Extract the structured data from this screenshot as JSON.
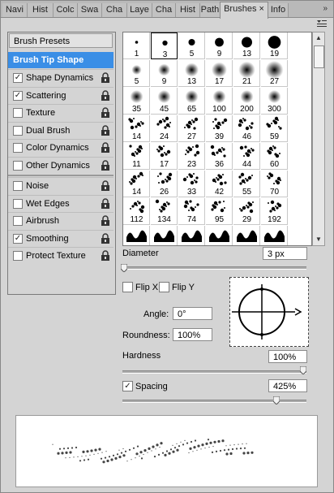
{
  "tabs": [
    "Navi",
    "Hist",
    "Colc",
    "Swa",
    "Cha",
    "Laye",
    "Cha",
    "Hist",
    "Path",
    "Brushes",
    "Info"
  ],
  "active_tab": "Brushes",
  "tab_close": "×",
  "panel_grip": "»",
  "presets_label": "Brush Presets",
  "options": [
    {
      "label": "Brush Tip Shape",
      "checked": null,
      "lock": false
    },
    {
      "label": "Shape Dynamics",
      "checked": true,
      "lock": true
    },
    {
      "label": "Scattering",
      "checked": true,
      "lock": true
    },
    {
      "label": "Texture",
      "checked": false,
      "lock": true
    },
    {
      "label": "Dual Brush",
      "checked": false,
      "lock": true
    },
    {
      "label": "Color Dynamics",
      "checked": false,
      "lock": true
    },
    {
      "label": "Other Dynamics",
      "checked": false,
      "lock": true
    },
    {
      "label": "Noise",
      "checked": false,
      "lock": true
    },
    {
      "label": "Wet Edges",
      "checked": false,
      "lock": true
    },
    {
      "label": "Airbrush",
      "checked": false,
      "lock": true
    },
    {
      "label": "Smoothing",
      "checked": true,
      "lock": true
    },
    {
      "label": "Protect Texture",
      "checked": false,
      "lock": true
    }
  ],
  "brushes": {
    "sizes": [
      "1",
      "3",
      "5",
      "9",
      "13",
      "19",
      "5",
      "9",
      "13",
      "17",
      "21",
      "27",
      "35",
      "45",
      "65",
      "100",
      "200",
      "300",
      "14",
      "24",
      "27",
      "39",
      "46",
      "59",
      "11",
      "17",
      "23",
      "36",
      "44",
      "60",
      "14",
      "26",
      "33",
      "42",
      "55",
      "70",
      "112",
      "134",
      "74",
      "95",
      "29",
      "192",
      "",
      "",
      "",
      "",
      "",
      ""
    ],
    "selected_index": 1
  },
  "diameter": {
    "label": "Diameter",
    "value": "3 px",
    "level": 0.01
  },
  "flip_x": {
    "label": "Flip X",
    "checked": false
  },
  "flip_y": {
    "label": "Flip Y",
    "checked": false
  },
  "angle": {
    "label": "Angle:",
    "value": "0°"
  },
  "roundness": {
    "label": "Roundness:",
    "value": "100%"
  },
  "hardness": {
    "label": "Hardness",
    "value": "100%",
    "level": 1.0
  },
  "spacing": {
    "label": "Spacing",
    "value": "425%",
    "checked": true,
    "level": 0.85
  },
  "colors": {
    "selected": "#3a8ee6",
    "panel": "#d4d4d4"
  }
}
